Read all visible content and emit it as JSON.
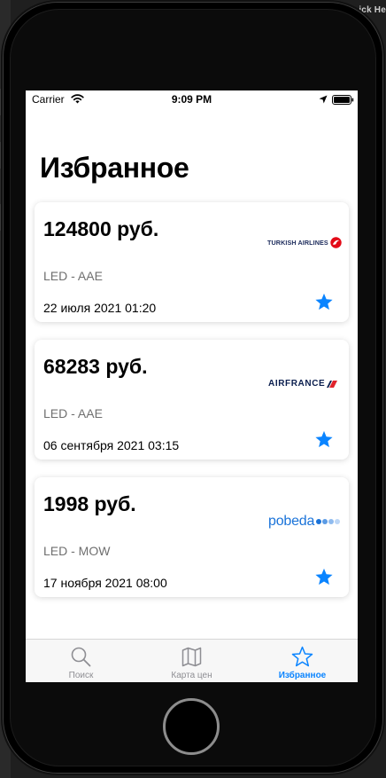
{
  "window": {
    "partial_title": "ick He"
  },
  "status_bar": {
    "carrier": "Carrier",
    "time": "9:09 PM"
  },
  "page": {
    "title": "Избранное"
  },
  "favorites": [
    {
      "price": "124800 руб.",
      "route": "LED - AAE",
      "date": "22 июля 2021 01:20",
      "airline": "TURKISH AIRLINES",
      "logo_icon": "turkish-airlines-logo"
    },
    {
      "price": "68283 руб.",
      "route": "LED - AAE",
      "date": "06 сентября 2021 03:15",
      "airline": "AIRFRANCE",
      "logo_icon": "air-france-logo"
    },
    {
      "price": "1998 руб.",
      "route": "LED - MOW",
      "date": "17 ноября 2021 08:00",
      "airline": "pobeda",
      "logo_icon": "pobeda-logo"
    }
  ],
  "tabs": [
    {
      "label": "Поиск",
      "icon": "search-icon",
      "active": false
    },
    {
      "label": "Карта цен",
      "icon": "map-icon",
      "active": false
    },
    {
      "label": "Избранное",
      "icon": "star-outline-icon",
      "active": true
    }
  ],
  "colors": {
    "accent": "#0a84ff",
    "turkish_red": "#e30a17",
    "airfrance_red": "#e0232c",
    "pobeda_blue": "#1a73d9"
  }
}
